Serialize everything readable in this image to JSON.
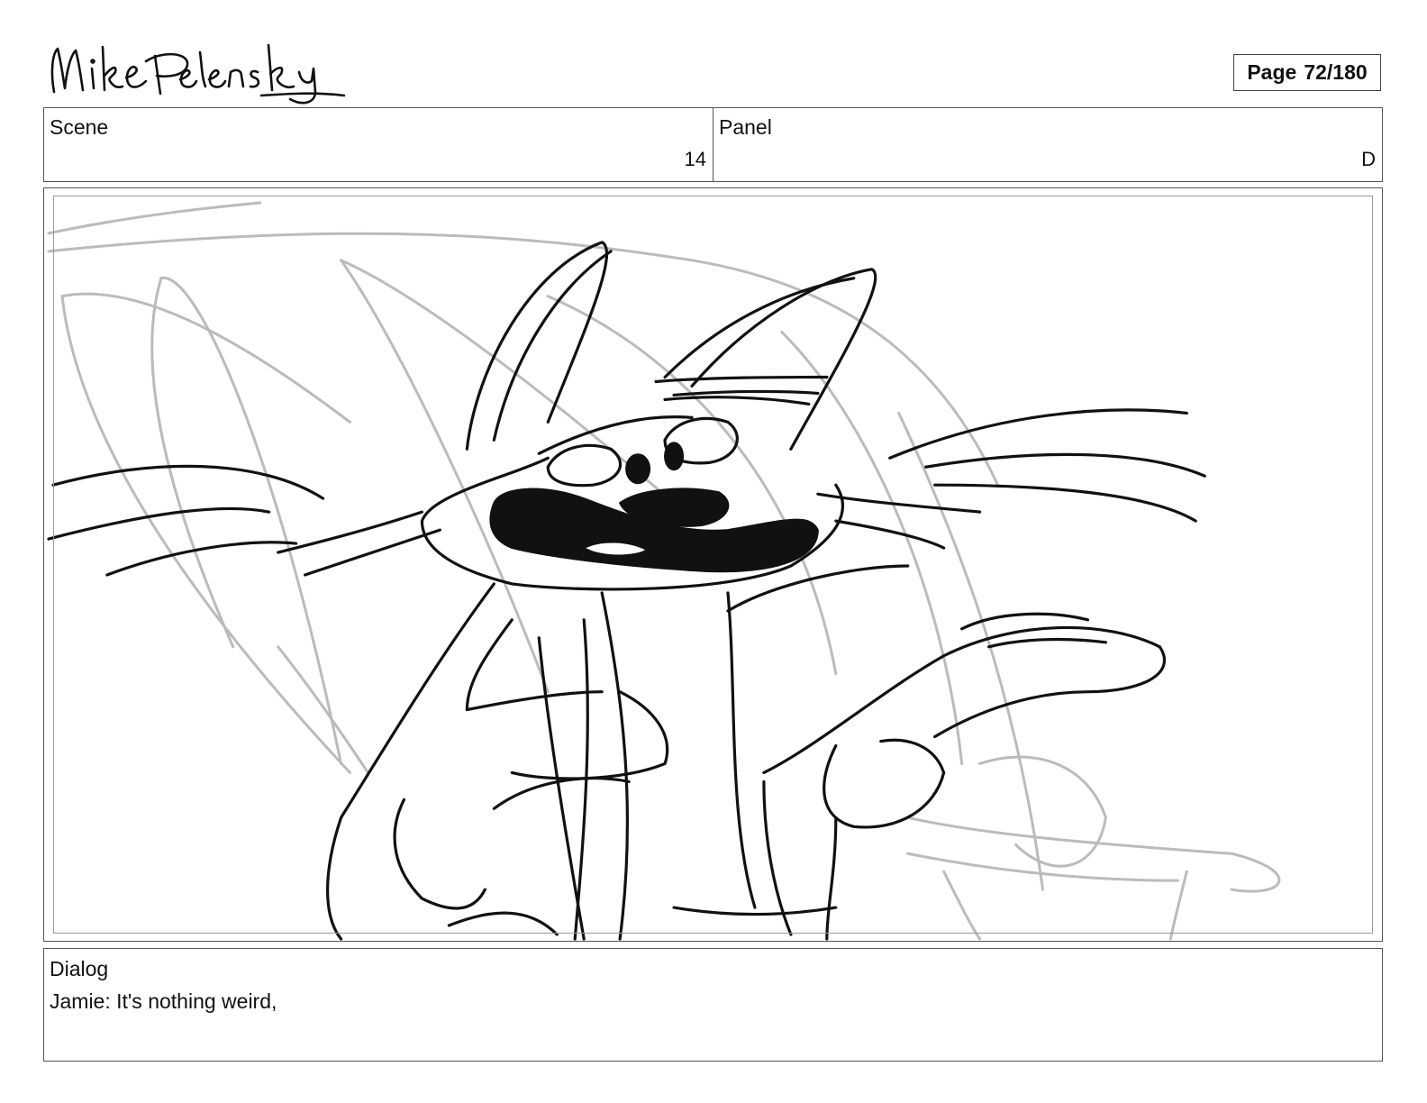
{
  "header": {
    "artist_signature": "Mike Pelensky",
    "page_label": "Page",
    "page_number": "72/180"
  },
  "info": {
    "scene_label": "Scene",
    "scene_value": "14",
    "panel_label": "Panel",
    "panel_value": "D"
  },
  "panel": {
    "image_description": "rough storyboard sketch of a cartoon cat character grinning and gesturing with one paw",
    "line_color": "#111111",
    "rough_color": "#bbbbbb"
  },
  "dialog": {
    "label": "Dialog",
    "text": "Jamie: It's nothing weird,"
  }
}
